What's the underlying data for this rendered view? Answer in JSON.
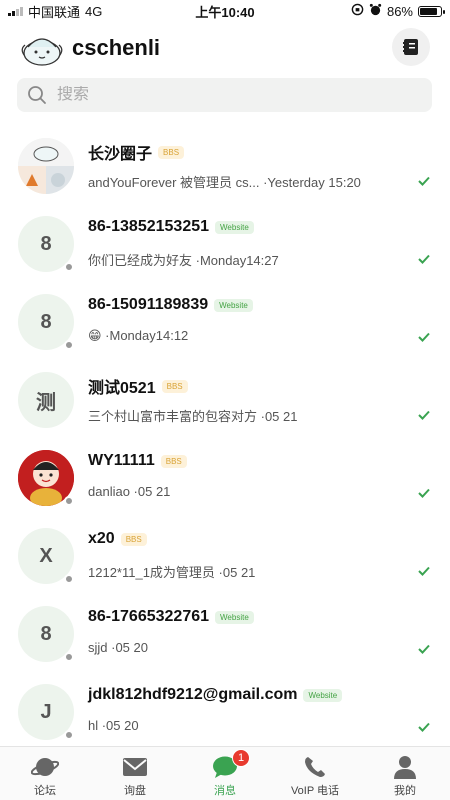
{
  "status_bar": {
    "carrier": "中国联通",
    "network": "4G",
    "time": "上午10:40",
    "battery": "86%",
    "battery_level": 0.86
  },
  "header": {
    "title": "cschenli",
    "logo_icon": "mascot-logo-icon",
    "action_icon": "address-book-icon"
  },
  "search": {
    "placeholder": "搜索"
  },
  "conversations": [
    {
      "name": "长沙圈子",
      "tag": "BBS",
      "tag_type": "bbs",
      "preview": "andYouForever 被管理员 cs... ·Yesterday 15:20",
      "avatar_text": "",
      "avatar_type": "group-image",
      "presence": false
    },
    {
      "name": "86-13852153251",
      "tag": "Website",
      "tag_type": "website",
      "preview": "你们已经成为好友 ·Monday14:27",
      "avatar_text": "8",
      "avatar_type": "letter",
      "presence": true
    },
    {
      "name": "86-15091189839",
      "tag": "Website",
      "tag_type": "website",
      "preview": "😁 ·Monday14:12",
      "avatar_text": "8",
      "avatar_type": "letter",
      "presence": true
    },
    {
      "name": "测试0521",
      "tag": "BBS",
      "tag_type": "bbs",
      "preview": "三个村山富市丰富的包容对方 ·05 21",
      "avatar_text": "测",
      "avatar_type": "letter",
      "presence": false
    },
    {
      "name": "WY11111",
      "tag": "BBS",
      "tag_type": "bbs",
      "preview": "danliao ·05 21",
      "avatar_text": "",
      "avatar_type": "cartoon-image",
      "presence": true
    },
    {
      "name": "x20",
      "tag": "BBS",
      "tag_type": "bbs",
      "preview": "1212*11_1成为管理员 ·05 21",
      "avatar_text": "X",
      "avatar_type": "letter",
      "presence": true
    },
    {
      "name": "86-17665322761",
      "tag": "Website",
      "tag_type": "website",
      "preview": "sjjd ·05 20",
      "avatar_text": "8",
      "avatar_type": "letter",
      "presence": true
    },
    {
      "name": "jdkl812hdf9212@gmail.com",
      "tag": "Website",
      "tag_type": "website",
      "preview": "hl ·05 20",
      "avatar_text": "J",
      "avatar_type": "letter",
      "presence": true
    }
  ],
  "tabbar": {
    "items": [
      {
        "label": "论坛",
        "icon": "planet-icon"
      },
      {
        "label": "询盘",
        "icon": "mail-icon"
      },
      {
        "label": "消息",
        "icon": "chat-bubble-icon",
        "badge": "1",
        "active": true
      },
      {
        "label": "VoIP 电话",
        "icon": "phone-icon"
      },
      {
        "label": "我的",
        "icon": "person-icon"
      }
    ]
  },
  "colors": {
    "accent": "#3aa351",
    "badge": "#e83a2e",
    "bbs_tag": "#d9a336",
    "website_tag": "#44a344",
    "avatar_bg": "#edf4ed"
  }
}
